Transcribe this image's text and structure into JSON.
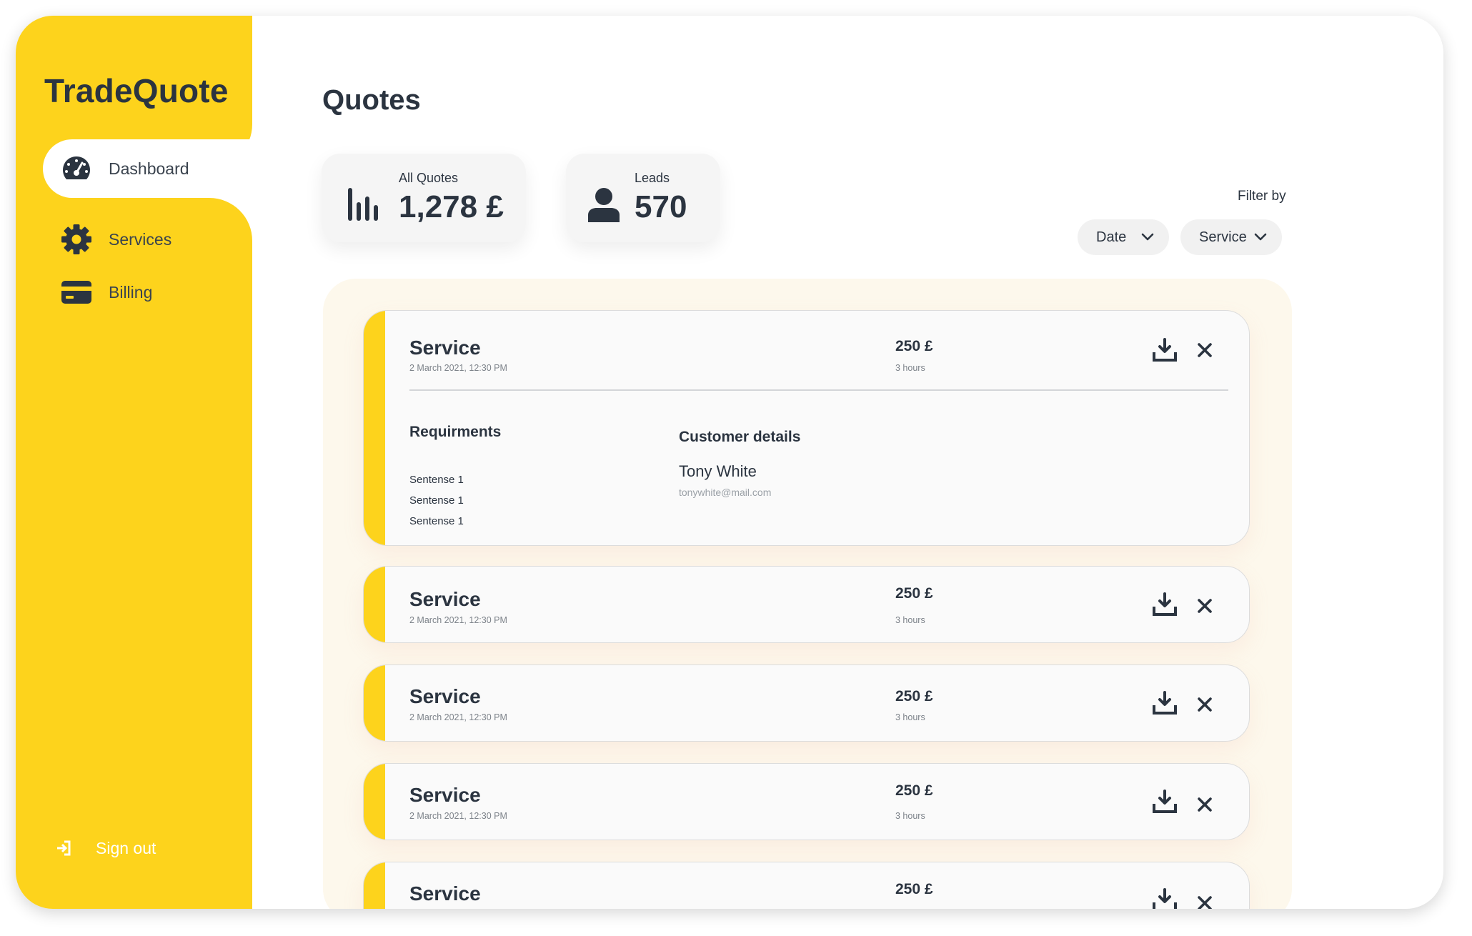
{
  "app": {
    "name": "TradeQuote"
  },
  "sidebar": {
    "items": [
      {
        "label": "Dashboard",
        "icon": "speedometer-icon",
        "active": true
      },
      {
        "label": "Services",
        "icon": "gear-icon",
        "active": false
      },
      {
        "label": "Billing",
        "icon": "credit-card-icon",
        "active": false
      }
    ],
    "signout": {
      "label": "Sign out",
      "icon": "sign-out-icon"
    }
  },
  "page": {
    "title": "Quotes"
  },
  "stats": {
    "all_quotes": {
      "label": "All Quotes",
      "value": "1,278 £",
      "icon": "bar-chart-icon"
    },
    "leads": {
      "label": "Leads",
      "value": "570",
      "icon": "person-icon"
    }
  },
  "filters": {
    "label": "Filter by",
    "date": {
      "label": "Date",
      "icon": "chevron-down-icon"
    },
    "service": {
      "label": "Service",
      "icon": "chevron-down-icon"
    }
  },
  "quotes": [
    {
      "service": "Service",
      "date": "2 March 2021,  12:30 PM",
      "price": "250 £",
      "duration": "3 hours",
      "expanded": true,
      "requirements_title": "Requirments",
      "requirements": [
        "Sentense 1",
        "Sentense 1",
        "Sentense 1"
      ],
      "customer_title": "Customer details",
      "customer_name": "Tony White",
      "customer_email": "tonywhite@mail.com"
    },
    {
      "service": "Service",
      "date": "2 March 2021,  12:30 PM",
      "price": "250 £",
      "duration": "3 hours"
    },
    {
      "service": "Service",
      "date": "2 March 2021,  12:30 PM",
      "price": "250 £",
      "duration": "3 hours"
    },
    {
      "service": "Service",
      "date": "2 March 2021,  12:30 PM",
      "price": "250 £",
      "duration": "3 hours"
    },
    {
      "service": "Service",
      "price": "250 £"
    }
  ],
  "colors": {
    "accent": "#fdd31c",
    "text": "#2b3440",
    "panel": "#fdf8ec"
  }
}
